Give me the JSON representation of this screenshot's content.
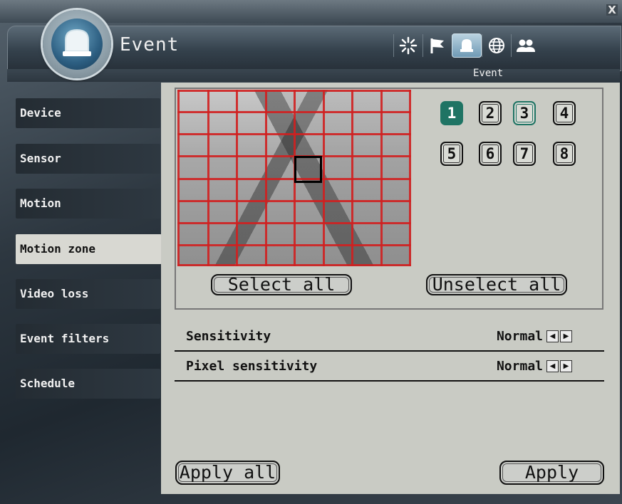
{
  "window": {
    "title": "Event",
    "close_label": "X"
  },
  "toolbar": {
    "items": [
      {
        "icon": "loading-star-icon"
      },
      {
        "icon": "flag-icon"
      },
      {
        "icon": "alarm-bell-icon",
        "active": true
      },
      {
        "icon": "globe-icon"
      },
      {
        "icon": "users-icon"
      }
    ],
    "active_label": "Event"
  },
  "sidebar": {
    "items": [
      {
        "label": "Device"
      },
      {
        "label": "Sensor"
      },
      {
        "label": "Motion"
      },
      {
        "label": "Motion zone",
        "active": true
      },
      {
        "label": "Video loss"
      },
      {
        "label": "Event filters"
      },
      {
        "label": "Schedule"
      }
    ]
  },
  "zone_editor": {
    "grid_rows": 8,
    "grid_cols": 8,
    "zones": [
      "1",
      "2",
      "3",
      "4",
      "5",
      "6",
      "7",
      "8"
    ],
    "selected_zone": "1",
    "select_all_label": "Select all",
    "unselect_all_label": "Unselect all"
  },
  "settings": {
    "sensitivity_label": "Sensitivity",
    "sensitivity_value": "Normal",
    "pixel_sensitivity_label": "Pixel sensitivity",
    "pixel_sensitivity_value": "Normal"
  },
  "footer": {
    "apply_all_label": "Apply all",
    "apply_label": "Apply"
  },
  "colors": {
    "accent": "#1f7464",
    "grid_line": "#d02020",
    "content_bg": "#c9cbc4"
  }
}
